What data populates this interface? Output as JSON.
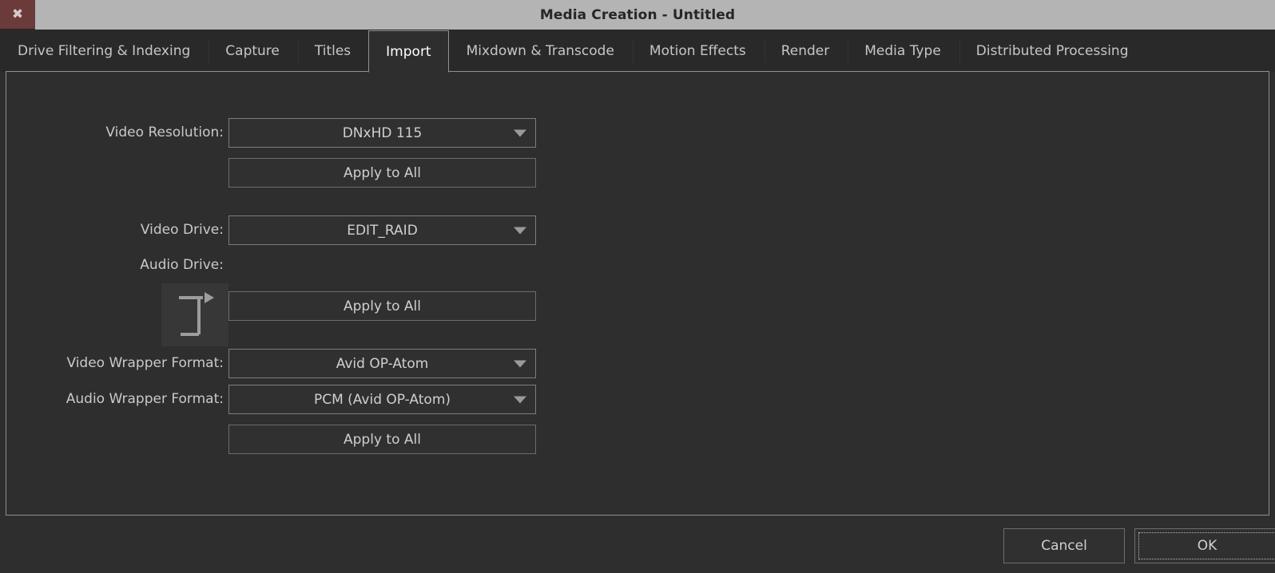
{
  "window": {
    "title": "Media Creation - Untitled",
    "close_icon": "close-icon",
    "close_glyph": "✖"
  },
  "tabs": [
    {
      "id": "drive-filtering-indexing",
      "label": "Drive Filtering & Indexing",
      "active": false
    },
    {
      "id": "capture",
      "label": "Capture",
      "active": false
    },
    {
      "id": "titles",
      "label": "Titles",
      "active": false
    },
    {
      "id": "import",
      "label": "Import",
      "active": true
    },
    {
      "id": "mixdown-transcode",
      "label": "Mixdown & Transcode",
      "active": false
    },
    {
      "id": "motion-effects",
      "label": "Motion Effects",
      "active": false
    },
    {
      "id": "render",
      "label": "Render",
      "active": false
    },
    {
      "id": "media-type",
      "label": "Media Type",
      "active": false
    },
    {
      "id": "distributed-processing",
      "label": "Distributed Processing",
      "active": false
    }
  ],
  "form": {
    "video_resolution": {
      "label": "Video Resolution:",
      "value": "DNxHD 115"
    },
    "apply_to_all_1": "Apply to All",
    "video_drive": {
      "label": "Video Drive:",
      "value": "EDIT_RAID"
    },
    "audio_drive": {
      "label": "Audio Drive:"
    },
    "drive_link_icon": "drive-link-bracket-icon",
    "apply_to_all_2": "Apply to All",
    "video_wrapper_format": {
      "label": "Video Wrapper Format:",
      "value": "Avid OP-Atom"
    },
    "audio_wrapper_format": {
      "label": "Audio Wrapper Format:",
      "value": "PCM (Avid OP-Atom)"
    },
    "apply_to_all_3": "Apply to All"
  },
  "footer": {
    "cancel_label": "Cancel",
    "ok_label": "OK"
  },
  "colors": {
    "titlebar_bg": "#b4b4b4",
    "close_button_bg": "#6b3a3a",
    "panel_bg": "#2e2e2e",
    "tabbar_bg": "#292929",
    "border": "#8f8f8f",
    "text": "#cfcfcf",
    "active_tab_text": "#ffffff"
  }
}
